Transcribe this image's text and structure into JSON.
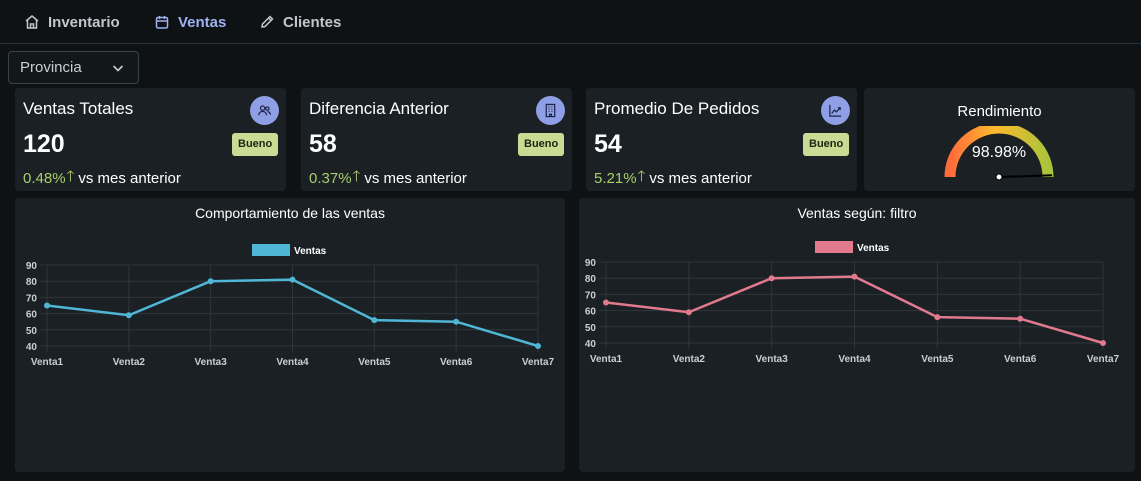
{
  "nav": {
    "items": [
      {
        "label": "Inventario",
        "icon": "home-icon"
      },
      {
        "label": "Ventas",
        "icon": "calendar-icon"
      },
      {
        "label": "Clientes",
        "icon": "pencil-icon"
      }
    ],
    "active": "Ventas"
  },
  "filter": {
    "selected": "Provincia",
    "icon": "chevron-down-icon"
  },
  "cards": [
    {
      "title": "Ventas Totales",
      "value": "120",
      "badge": "Bueno",
      "pct": "0.48%",
      "trend_text": "vs mes anterior",
      "icon": "users-icon"
    },
    {
      "title": "Diferencia Anterior",
      "value": "58",
      "badge": "Bueno",
      "pct": "0.37%",
      "trend_text": "vs mes anterior",
      "icon": "building-icon"
    },
    {
      "title": "Promedio De Pedidos",
      "value": "54",
      "badge": "Bueno",
      "pct": "5.21%",
      "trend_text": "vs mes anterior",
      "icon": "trending-up-icon"
    }
  ],
  "performance": {
    "title": "Rendimiento",
    "value_label": "98.98%",
    "value": 98.98,
    "max": 100
  },
  "colors": {
    "accent": "#9fb2f0",
    "positive": "#a8cf6a",
    "badge": "#c8dd93",
    "series1": "#4fb6d6",
    "series2": "#e07a8c"
  },
  "chart_data": [
    {
      "type": "line",
      "title": "Comportamiento de las ventas",
      "categories": [
        "Venta1",
        "Venta2",
        "Venta3",
        "Venta4",
        "Venta5",
        "Venta6",
        "Venta7"
      ],
      "series": [
        {
          "name": "Ventas",
          "values": [
            65,
            59,
            80,
            81,
            56,
            55,
            40
          ]
        }
      ],
      "ylim": [
        40,
        90
      ],
      "yticks": [
        40,
        50,
        60,
        70,
        80,
        90
      ],
      "grid": true,
      "legend": "top-center"
    },
    {
      "type": "line",
      "title": "Ventas según: filtro",
      "categories": [
        "Venta1",
        "Venta2",
        "Venta3",
        "Venta4",
        "Venta5",
        "Venta6",
        "Venta7"
      ],
      "series": [
        {
          "name": "Ventas",
          "values": [
            65,
            59,
            80,
            81,
            56,
            55,
            40
          ]
        }
      ],
      "ylim": [
        40,
        90
      ],
      "yticks": [
        40,
        50,
        60,
        70,
        80,
        90
      ],
      "grid": true,
      "legend": "top-center"
    }
  ]
}
